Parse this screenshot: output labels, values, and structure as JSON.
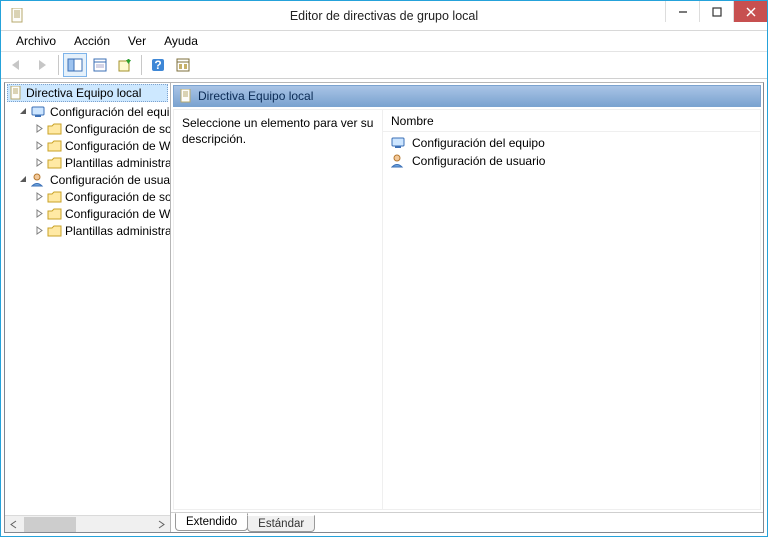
{
  "window": {
    "title": "Editor de directivas de grupo local"
  },
  "menu": {
    "items": [
      "Archivo",
      "Acción",
      "Ver",
      "Ayuda"
    ]
  },
  "tree": {
    "root": "Directiva Equipo local",
    "groups": [
      {
        "label": "Configuración del equipo",
        "icon": "pc",
        "children": [
          "Configuración de software",
          "Configuración de Windows",
          "Plantillas administrativas"
        ]
      },
      {
        "label": "Configuración de usuario",
        "icon": "user",
        "children": [
          "Configuración de software",
          "Configuración de Windows",
          "Plantillas administrativas"
        ]
      }
    ]
  },
  "main": {
    "heading": "Directiva Equipo local",
    "description": "Seleccione un elemento para ver su descripción.",
    "columnHeader": "Nombre",
    "items": [
      {
        "label": "Configuración del equipo",
        "icon": "pc"
      },
      {
        "label": "Configuración de usuario",
        "icon": "user"
      }
    ],
    "tabs": {
      "active": "Extendido",
      "inactive": "Estándar"
    }
  }
}
